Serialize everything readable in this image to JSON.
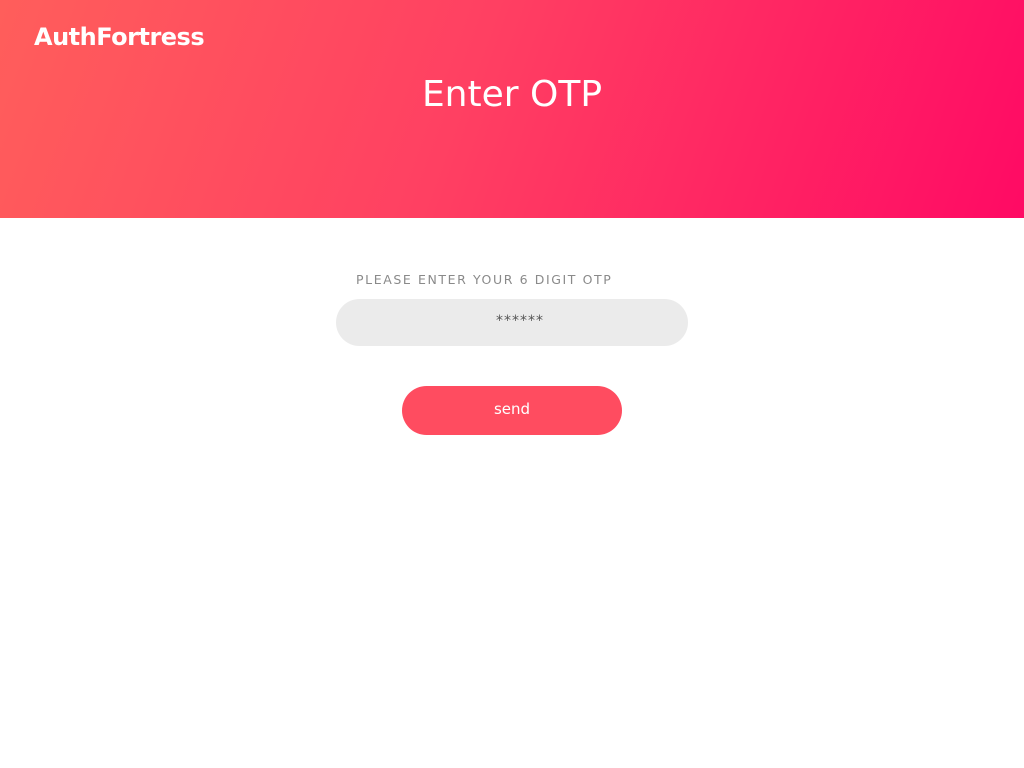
{
  "header": {
    "logo_text": "AuthFortress",
    "title": "Enter OTP"
  },
  "form": {
    "label": "PLEASE ENTER YOUR 6 DIGIT OTP",
    "otp_placeholder": "******",
    "otp_value": "",
    "submit_label": "send"
  },
  "colors": {
    "gradient_start": "#ff5e5b",
    "gradient_end": "#ff0a64",
    "button": "#ff4c60",
    "input_background": "#ebebeb",
    "label_text": "#8a8a8a"
  }
}
